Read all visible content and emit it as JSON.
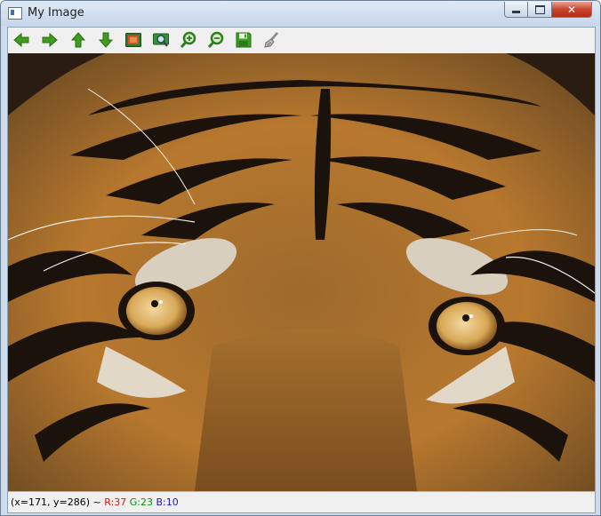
{
  "window": {
    "title": "My Image"
  },
  "toolbar": {
    "items": [
      {
        "name": "arrow-left-icon"
      },
      {
        "name": "arrow-right-icon"
      },
      {
        "name": "arrow-up-icon"
      },
      {
        "name": "arrow-down-icon"
      },
      {
        "name": "image-fit-icon"
      },
      {
        "name": "zoom-area-icon"
      },
      {
        "name": "zoom-in-icon"
      },
      {
        "name": "zoom-out-icon"
      },
      {
        "name": "save-icon"
      },
      {
        "name": "properties-brush-icon"
      }
    ]
  },
  "status": {
    "coords": "(x=171, y=286) ~ ",
    "r": "R:37",
    "g": "G:23",
    "b": "B:10"
  },
  "colors": {
    "arrow_green": "#3f9c1e",
    "fur_orange": "#b8782e",
    "stripe": "#1a120b"
  }
}
